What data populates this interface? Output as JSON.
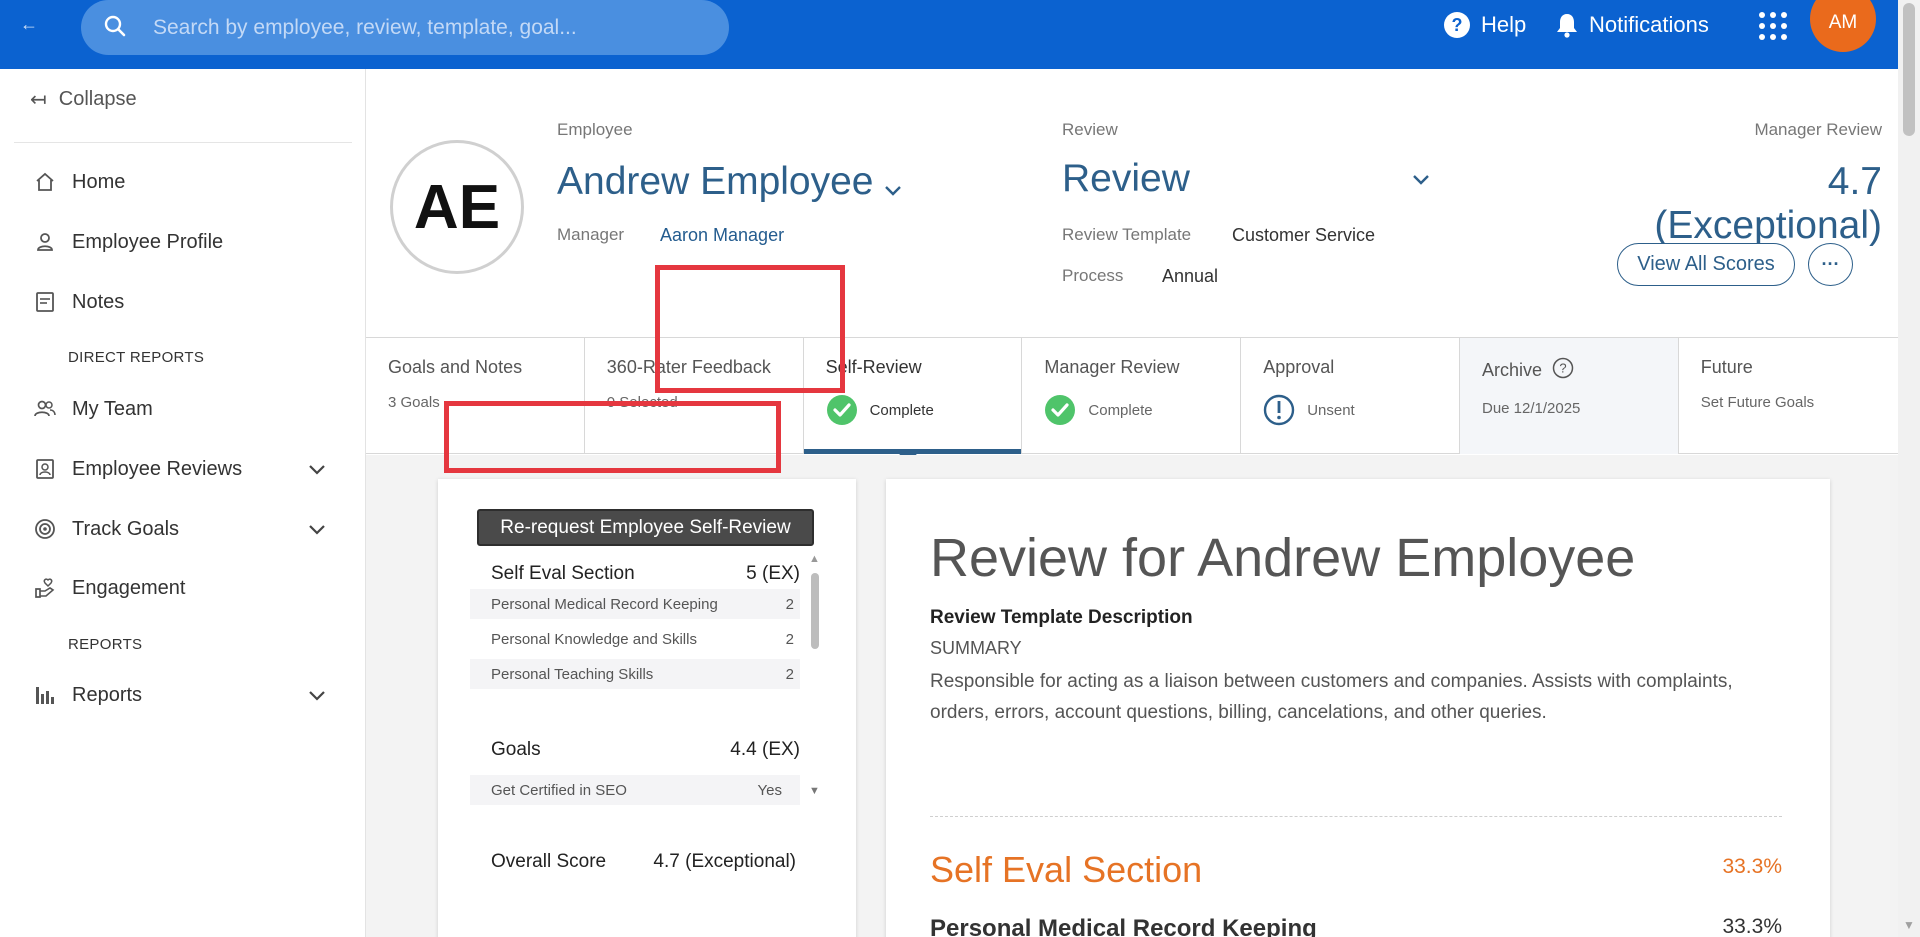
{
  "topbar": {
    "search_placeholder": "Search by employee, review, template, goal...",
    "help_label": "Help",
    "notifications_label": "Notifications",
    "user_initials": "AM",
    "brand_color": "#0b62d0",
    "avatar_color": "#ea6a1c"
  },
  "sidebar": {
    "collapse_label": "Collapse",
    "items": [
      {
        "label": "Home",
        "icon": "home-icon"
      },
      {
        "label": "Employee Profile",
        "icon": "person-icon"
      },
      {
        "label": "Notes",
        "icon": "notes-icon"
      },
      {
        "label": "My Team",
        "icon": "team-icon"
      },
      {
        "label": "Employee Reviews",
        "icon": "review-badge-icon"
      },
      {
        "label": "Track Goals",
        "icon": "target-icon"
      },
      {
        "label": "Engagement",
        "icon": "engagement-icon"
      },
      {
        "label": "Reports",
        "icon": "bar-chart-icon"
      }
    ],
    "headings": {
      "direct_reports": "DIRECT REPORTS",
      "reports": "REPORTS"
    }
  },
  "header": {
    "employee_label": "Employee",
    "employee_name": "Andrew Employee",
    "employee_initials": "AE",
    "manager_label": "Manager",
    "manager_name": "Aaron Manager",
    "review_label": "Review",
    "review_name": "Review",
    "template_label": "Review Template",
    "template_value": "Customer Service",
    "process_label": "Process",
    "process_value": "Annual",
    "manager_review_label": "Manager Review",
    "manager_review_score": "4.7 (Exceptional)",
    "view_scores_label": "View All Scores",
    "more_label": "···"
  },
  "tabs": [
    {
      "title": "Goals and Notes",
      "sub": "3 Goals",
      "status": "none"
    },
    {
      "title": "360-Rater Feedback",
      "sub": "0 Selected",
      "status": "none"
    },
    {
      "title": "Self-Review",
      "sub": "Complete",
      "status": "complete"
    },
    {
      "title": "Manager Review",
      "sub": "Complete",
      "status": "complete"
    },
    {
      "title": "Approval",
      "sub": "Unsent",
      "status": "alert"
    },
    {
      "title": "Archive",
      "sub": "Due 12/1/2025",
      "status": "none"
    },
    {
      "title": "Future",
      "sub": "Set Future Goals",
      "status": "none"
    }
  ],
  "left_panel": {
    "rerequest_label": "Re-request Employee Self-Review",
    "self_eval": {
      "title": "Self Eval Section",
      "score": "5 (EX)",
      "rows": [
        {
          "label": "Personal Medical Record Keeping",
          "value": "2"
        },
        {
          "label": "Personal Knowledge and Skills",
          "value": "2"
        },
        {
          "label": "Personal Teaching Skills",
          "value": "2"
        }
      ]
    },
    "goals": {
      "title": "Goals",
      "score": "4.4 (EX)",
      "rows": [
        {
          "label": "Get Certified in SEO",
          "value": "Yes"
        }
      ]
    },
    "overall_label": "Overall Score",
    "overall_value": "4.7 (Exceptional)"
  },
  "right_panel": {
    "title": "Review for Andrew Employee",
    "template_desc_label": "Review Template Description",
    "summary_label": "SUMMARY",
    "description": "Responsible for acting as a liaison between customers and companies. Assists with complaints, orders, errors, account questions, billing, cancelations, and other queries.",
    "section_title": "Self Eval Section",
    "section_pct": "33.3%",
    "subsection_title": "Personal Medical Record Keeping",
    "subsection_pct": "33.3%",
    "accent_color": "#e67325"
  }
}
